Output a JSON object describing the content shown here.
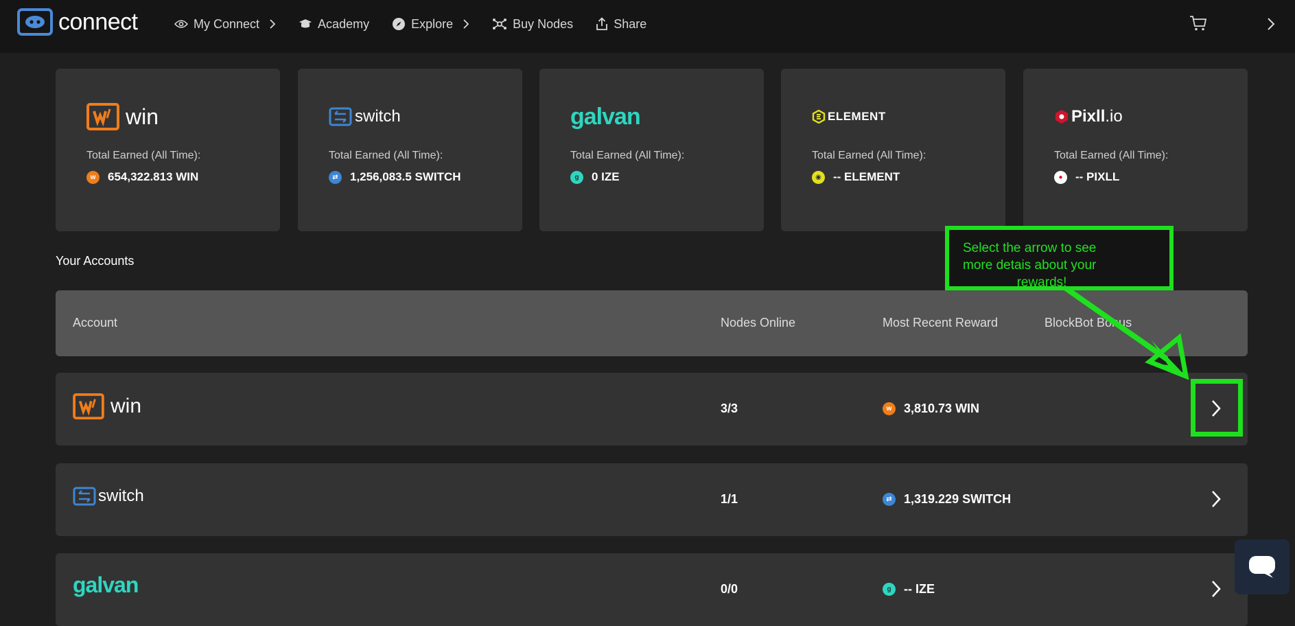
{
  "header": {
    "logo_text": "connect",
    "nav": [
      {
        "label": "My Connect",
        "icon": "eye-icon",
        "has_chevron": true
      },
      {
        "label": "Academy",
        "icon": "graduation-cap-icon",
        "has_chevron": false
      },
      {
        "label": "Explore",
        "icon": "compass-icon",
        "has_chevron": true
      },
      {
        "label": "Buy Nodes",
        "icon": "nodes-icon",
        "has_chevron": false
      },
      {
        "label": "Share",
        "icon": "share-icon",
        "has_chevron": false
      }
    ],
    "cart_icon": "cart-icon",
    "side_icon": "chevron-right-icon"
  },
  "colors": {
    "win": "#f07d1a",
    "switch": "#3d86d4",
    "galvan": "#2ed6c0",
    "element": "#e3e01e",
    "pixll": "#d0142c",
    "annotation": "#1ee01e"
  },
  "cards": [
    {
      "brand": "win",
      "label": "Total Earned (All Time):",
      "value": "654,322.813 WIN"
    },
    {
      "brand": "switch",
      "label": "Total Earned (All Time):",
      "value": "1,256,083.5 SWITCH"
    },
    {
      "brand": "galvan",
      "label": "Total Earned (All Time):",
      "value": "0 IZE"
    },
    {
      "brand": "ELEMENT",
      "label": "Total Earned (All Time):",
      "value": "-- ELEMENT"
    },
    {
      "brand": "Pixll",
      "brand_suffix": ".io",
      "label": "Total Earned (All Time):",
      "value": "-- PIXLL"
    }
  ],
  "accounts": {
    "title": "Your Accounts",
    "columns": [
      "Account",
      "Nodes Online",
      "Most Recent Reward",
      "BlockBot Bonus"
    ],
    "rows": [
      {
        "account": "win",
        "nodes_online": "3/3",
        "recent_reward": "3,810.73 WIN"
      },
      {
        "account": "switch",
        "nodes_online": "1/1",
        "recent_reward": "1,319.229 SWITCH"
      },
      {
        "account": "galvan",
        "nodes_online": "0/0",
        "recent_reward": "-- IZE"
      }
    ]
  },
  "annotation": {
    "line1": "Select the arrow to see",
    "line2": "more detais about your",
    "line3": "rewards!"
  },
  "chat_icon": "chat-bubble-icon"
}
